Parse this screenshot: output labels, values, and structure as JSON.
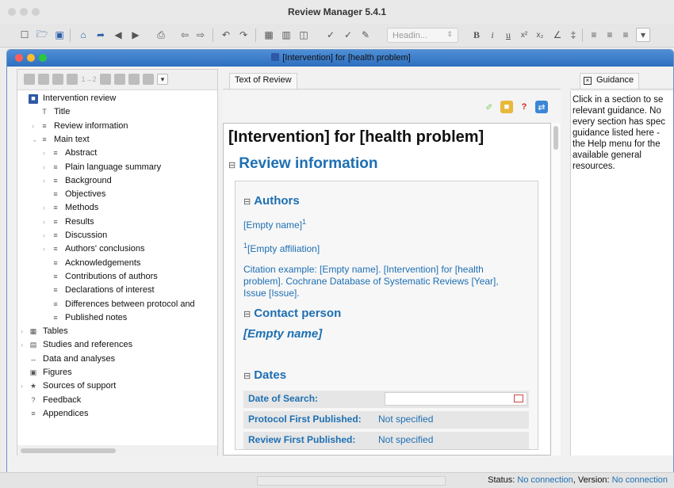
{
  "app": {
    "title": "Review Manager 5.4.1"
  },
  "toolbar": {
    "style_select": "Headin..."
  },
  "doc_window": {
    "title": "[Intervention] for [health problem]"
  },
  "left_toolbar": {
    "counter": "1→2"
  },
  "tree": [
    {
      "label": "Intervention review",
      "level": 0,
      "icon": "review-icon",
      "chevron": ""
    },
    {
      "label": "Title",
      "level": 1,
      "icon": "title-icon",
      "chevron": ""
    },
    {
      "label": "Review information",
      "level": 1,
      "icon": "doc-icon",
      "chevron": "›"
    },
    {
      "label": "Main text",
      "level": 1,
      "icon": "doc-icon",
      "chevron": "⌄"
    },
    {
      "label": "Abstract",
      "level": 2,
      "icon": "doc-icon",
      "chevron": "›"
    },
    {
      "label": "Plain language summary",
      "level": 2,
      "icon": "doc-icon",
      "chevron": "›"
    },
    {
      "label": "Background",
      "level": 2,
      "icon": "doc-icon",
      "chevron": "›"
    },
    {
      "label": "Objectives",
      "level": 2,
      "icon": "doc-icon",
      "chevron": ""
    },
    {
      "label": "Methods",
      "level": 2,
      "icon": "doc-icon",
      "chevron": "›"
    },
    {
      "label": "Results",
      "level": 2,
      "icon": "doc-icon",
      "chevron": "›"
    },
    {
      "label": "Discussion",
      "level": 2,
      "icon": "doc-icon",
      "chevron": "›"
    },
    {
      "label": "Authors' conclusions",
      "level": 2,
      "icon": "doc-icon",
      "chevron": "›"
    },
    {
      "label": "Acknowledgements",
      "level": 2,
      "icon": "doc-icon",
      "chevron": ""
    },
    {
      "label": "Contributions of authors",
      "level": 2,
      "icon": "doc-icon",
      "chevron": ""
    },
    {
      "label": "Declarations of interest",
      "level": 2,
      "icon": "doc-icon",
      "chevron": ""
    },
    {
      "label": "Differences between protocol and",
      "level": 2,
      "icon": "doc-icon",
      "chevron": ""
    },
    {
      "label": "Published notes",
      "level": 2,
      "icon": "doc-icon",
      "chevron": ""
    },
    {
      "label": "Tables",
      "level": 0,
      "icon": "table-icon",
      "chevron": "›"
    },
    {
      "label": "Studies and references",
      "level": 0,
      "icon": "book-icon",
      "chevron": "›"
    },
    {
      "label": "Data and analyses",
      "level": 0,
      "icon": "data-icon",
      "chevron": ""
    },
    {
      "label": "Figures",
      "level": 0,
      "icon": "image-icon",
      "chevron": ""
    },
    {
      "label": "Sources of support",
      "level": 0,
      "icon": "support-icon",
      "chevron": "›"
    },
    {
      "label": "Feedback",
      "level": 0,
      "icon": "feedback-icon",
      "chevron": ""
    },
    {
      "label": "Appendices",
      "level": 0,
      "icon": "doc-icon",
      "chevron": ""
    }
  ],
  "center": {
    "tab": "Text of Review",
    "heading": "[Intervention] for [health problem]",
    "section": "Review information",
    "collapse_glyph": "⊟",
    "authors_heading": "Authors",
    "author_name": "[Empty name]",
    "author_sup": "1",
    "affiliation": "[Empty affiliation]",
    "affiliation_sup": "1",
    "citation": "Citation example: [Empty name]. [Intervention] for [health problem]. Cochrane Database of Systematic Reviews [Year], Issue [Issue].",
    "contact_heading": "Contact person",
    "contact_name": "[Empty name]",
    "dates_heading": "Dates",
    "dates": [
      {
        "label": "Date of Search:",
        "value": ""
      },
      {
        "label": "Protocol First Published:",
        "value": "Not specified"
      },
      {
        "label": "Review First Published:",
        "value": "Not specified"
      }
    ]
  },
  "guidance": {
    "tab": "Guidance",
    "lines": [
      "Click in a section to se",
      "relevant guidance. No",
      "every section has spec",
      "guidance listed here -",
      "the Help menu for the",
      "available general",
      "resources."
    ]
  },
  "status": {
    "label": "Status:",
    "status_value": "No connection",
    "version_label": ", Version:",
    "version_value": "No connection"
  }
}
